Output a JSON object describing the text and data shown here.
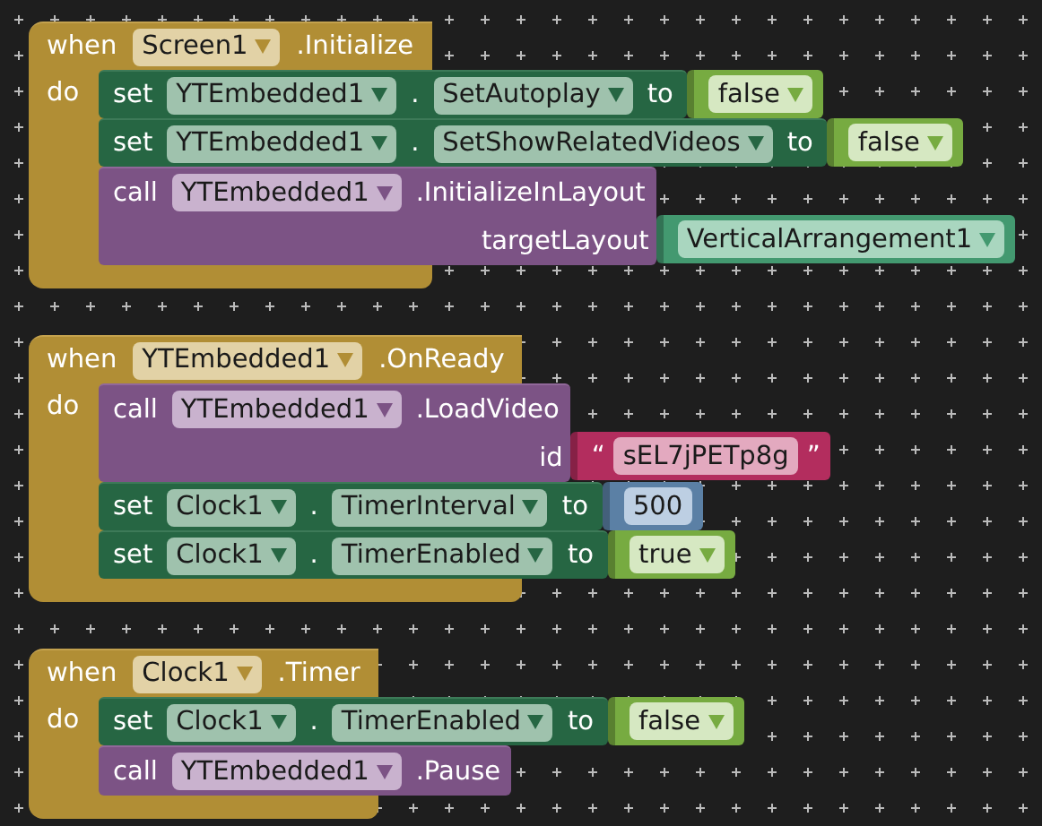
{
  "events": [
    {
      "keyword": "when",
      "component": "Screen1",
      "event": ".Initialize",
      "do_label": "do",
      "statements": [
        {
          "kind": "set",
          "keyword": "set",
          "component": "YTEmbedded1",
          "dot": ".",
          "property": "SetAutoplay",
          "to": "to",
          "value": {
            "kind": "boolean",
            "text": "false"
          }
        },
        {
          "kind": "set",
          "keyword": "set",
          "component": "YTEmbedded1",
          "dot": ".",
          "property": "SetShowRelatedVideos",
          "to": "to",
          "value": {
            "kind": "boolean",
            "text": "false"
          }
        },
        {
          "kind": "call",
          "keyword": "call",
          "component": "YTEmbedded1",
          "method": ".InitializeInLayout",
          "args": [
            {
              "name": "targetLayout",
              "value": {
                "kind": "component",
                "text": "VerticalArrangement1"
              }
            }
          ]
        }
      ]
    },
    {
      "keyword": "when",
      "component": "YTEmbedded1",
      "event": ".OnReady",
      "do_label": "do",
      "statements": [
        {
          "kind": "call",
          "keyword": "call",
          "component": "YTEmbedded1",
          "method": ".LoadVideo",
          "args": [
            {
              "name": "id",
              "value": {
                "kind": "text",
                "open_quote": "“",
                "text": "sEL7jPETp8g",
                "close_quote": "”"
              }
            }
          ]
        },
        {
          "kind": "set",
          "keyword": "set",
          "component": "Clock1",
          "dot": ".",
          "property": "TimerInterval",
          "to": "to",
          "value": {
            "kind": "number",
            "text": "500"
          }
        },
        {
          "kind": "set",
          "keyword": "set",
          "component": "Clock1",
          "dot": ".",
          "property": "TimerEnabled",
          "to": "to",
          "value": {
            "kind": "boolean",
            "text": "true"
          }
        }
      ]
    },
    {
      "keyword": "when",
      "component": "Clock1",
      "event": ".Timer",
      "do_label": "do",
      "statements": [
        {
          "kind": "set",
          "keyword": "set",
          "component": "Clock1",
          "dot": ".",
          "property": "TimerEnabled",
          "to": "to",
          "value": {
            "kind": "boolean",
            "text": "false"
          }
        },
        {
          "kind": "call",
          "keyword": "call",
          "component": "YTEmbedded1",
          "method": ".Pause"
        }
      ]
    }
  ]
}
